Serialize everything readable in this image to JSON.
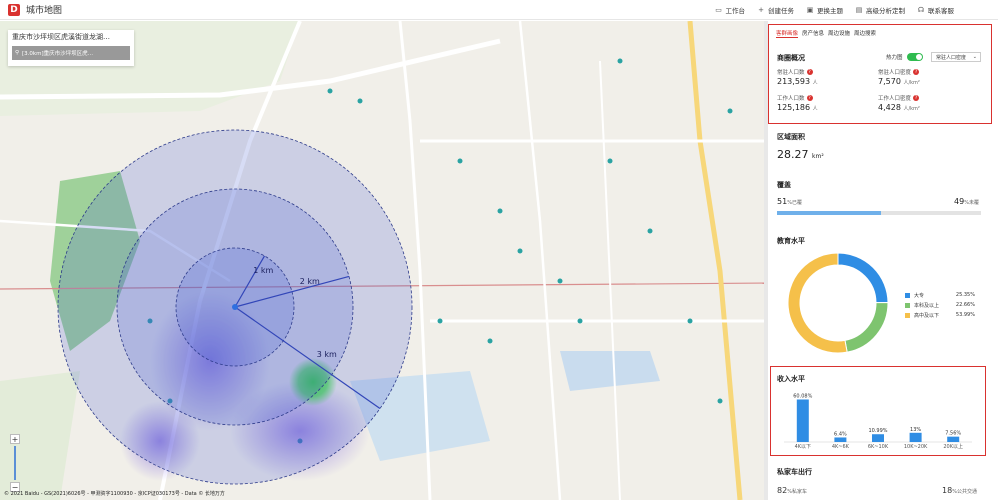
{
  "app": {
    "title": "城市地图",
    "logo_letter": "D"
  },
  "toolbar": {
    "workbench": "工作台",
    "create_task": "创建任务",
    "switch_theme": "更换主题",
    "advanced_custom": "高级分析定制",
    "contact_support": "联系客服"
  },
  "search": {
    "value": "重庆市沙坪坝区虎溪街道龙湖…",
    "result_label": "[3.0km]重庆市沙坪坝区虎…"
  },
  "map": {
    "rings": [
      {
        "label": "1 km",
        "radius_km": 1
      },
      {
        "label": "2 km",
        "radius_km": 2
      },
      {
        "label": "3 km",
        "radius_km": 3
      }
    ],
    "ring_color": "#4b5fd1",
    "copyright": "© 2021 Baidu - GS(2021)6026号 - 甲测资字1100930 - 京ICP证030173号 - Data © 长地万方",
    "zoom_plus": "+",
    "zoom_minus": "−"
  },
  "panel": {
    "tabs": [
      "客群画像",
      "房产信息",
      "周边设施",
      "周边搜索"
    ],
    "active_tab": 0,
    "overview": {
      "title": "商圈概况",
      "heat_label": "热力图",
      "heat_on": true,
      "dropdown": "常驻人口密度",
      "resident_pop_label": "常驻人口数",
      "resident_pop_value": "213,593",
      "resident_pop_unit": "人",
      "resident_density_label": "常驻人口密度",
      "resident_density_value": "7,570",
      "resident_density_unit": "人/km²",
      "work_pop_label": "工作人口数",
      "work_pop_value": "125,186",
      "work_pop_unit": "人",
      "work_density_label": "工作人口密度",
      "work_density_value": "4,428",
      "work_density_unit": "人/km²"
    },
    "area": {
      "title": "区域面积",
      "value": "28.27",
      "unit": "km²"
    },
    "coverage": {
      "title": "覆盖",
      "left_value": "51",
      "left_unit": "%已覆",
      "right_value": "49",
      "right_unit": "%未覆",
      "fraction": 0.51
    },
    "education": {
      "title": "教育水平",
      "items": [
        {
          "label": "大专",
          "pct": "25.35%",
          "value": 25.35,
          "color": "#2f8de4"
        },
        {
          "label": "本科及以上",
          "pct": "22.66%",
          "value": 22.66,
          "color": "#7ec46f"
        },
        {
          "label": "高中及以下",
          "pct": "53.99%",
          "value": 53.99,
          "color": "#f5c04a"
        }
      ]
    },
    "income": {
      "title": "收入水平"
    },
    "car": {
      "title": "私家车出行",
      "left_value": "82",
      "left_unit": "%私家车",
      "right_value": "18",
      "right_unit": "%公共交通"
    }
  },
  "chart_data": {
    "type": "bar",
    "title": "收入水平",
    "categories": [
      "4K以下",
      "4K~6K",
      "6K~10K",
      "10K~20K",
      "20K以上"
    ],
    "values": [
      60.08,
      6.4,
      10.99,
      13,
      7.56
    ],
    "value_labels": [
      "60.08%",
      "6.4%",
      "10.99%",
      "13%",
      "7.56%"
    ],
    "ylim": [
      0,
      65
    ],
    "color": "#2f8de4",
    "grid": false
  }
}
